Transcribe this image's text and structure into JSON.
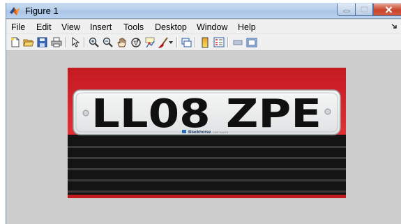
{
  "window": {
    "title": "Figure 1",
    "icon": "matlab-icon",
    "controls": [
      "minimize-icon",
      "maximize-icon",
      "close-icon"
    ]
  },
  "menubar": {
    "items": [
      "File",
      "Edit",
      "View",
      "Insert",
      "Tools",
      "Desktop",
      "Window",
      "Help"
    ]
  },
  "toolbar": {
    "tools": [
      "new-figure-icon",
      "open-file-icon",
      "save-figure-icon",
      "print-figure-icon",
      "edit-plot-icon",
      "zoom-in-icon",
      "zoom-out-icon",
      "pan-icon",
      "rotate-3d-icon",
      "data-cursor-icon",
      "brush-icon",
      "link-plot-icon",
      "insert-colorbar-icon",
      "insert-legend-icon",
      "hide-plot-tools-icon",
      "show-plot-tools-icon"
    ]
  },
  "image": {
    "plate_text": "LL08 ZPE",
    "dealer_name": "Blackhorse",
    "dealer_suffix": "CAR SALES",
    "colors": {
      "figure_background": "#cdcdcd",
      "car_body": "#d8262b",
      "plate": "#eef0f0",
      "plate_text": "#101010",
      "grille": "#1a1a1a",
      "dealer_logo": "#2a6fb5"
    }
  }
}
